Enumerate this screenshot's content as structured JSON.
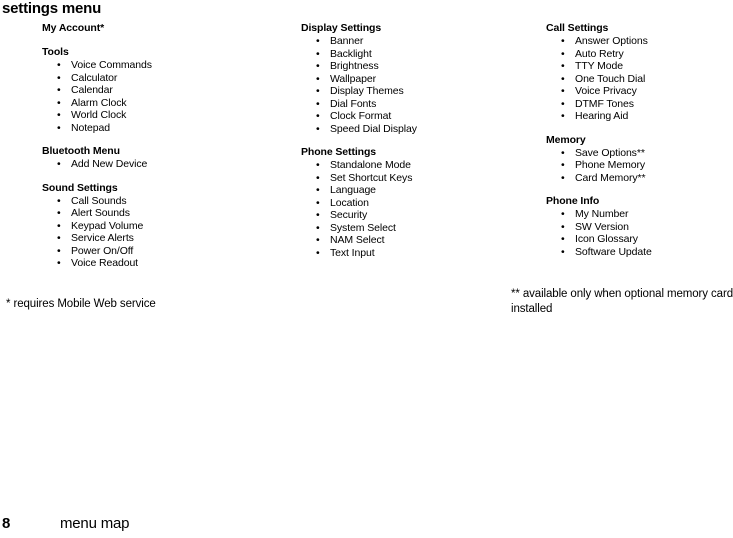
{
  "page": {
    "title": "settings menu",
    "number": "8",
    "footer_label": "menu map"
  },
  "footnotes": {
    "left": "* requires Mobile Web service",
    "right": "** available only when optional memory card installed"
  },
  "columns": [
    {
      "id": "column-1",
      "sections": [
        {
          "heading": "My Account*",
          "items": []
        },
        {
          "heading": "Tools",
          "items": [
            "Voice Commands",
            "Calculator",
            "Calendar",
            "Alarm Clock",
            "World Clock",
            "Notepad"
          ]
        },
        {
          "heading": "Bluetooth Menu",
          "items": [
            "Add New Device"
          ]
        },
        {
          "heading": "Sound Settings",
          "items": [
            "Call Sounds",
            "Alert Sounds",
            "Keypad Volume",
            "Service Alerts",
            "Power On/Off",
            "Voice Readout"
          ]
        }
      ]
    },
    {
      "id": "column-2",
      "sections": [
        {
          "heading": "Display Settings",
          "items": [
            "Banner",
            "Backlight",
            "Brightness",
            "Wallpaper",
            "Display Themes",
            "Dial Fonts",
            "Clock Format",
            "Speed Dial Display"
          ]
        },
        {
          "heading": "Phone Settings",
          "items": [
            "Standalone Mode",
            "Set Shortcut Keys",
            "Language",
            "Location",
            "Security",
            "System Select",
            "NAM Select",
            "Text Input"
          ]
        }
      ]
    },
    {
      "id": "column-3",
      "sections": [
        {
          "heading": "Call Settings",
          "items": [
            "Answer Options",
            "Auto Retry",
            "TTY Mode",
            "One Touch Dial",
            "Voice Privacy",
            "DTMF Tones",
            "Hearing Aid"
          ]
        },
        {
          "heading": "Memory",
          "items": [
            "Save Options**",
            "Phone Memory",
            "Card Memory**"
          ]
        },
        {
          "heading": "Phone Info",
          "items": [
            "My Number",
            "SW Version",
            "Icon Glossary",
            "Software Update"
          ]
        }
      ]
    }
  ],
  "bullet_glyph": "•"
}
